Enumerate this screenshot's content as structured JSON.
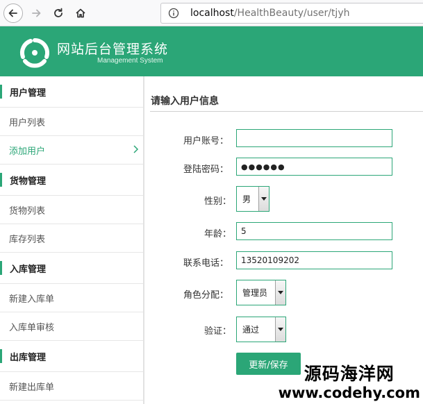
{
  "browser": {
    "url_host": "localhost",
    "url_path": "/HealthBeauty/user/tjyh"
  },
  "header": {
    "title": "网站后台管理系统",
    "subtitle": "Management System"
  },
  "sidebar": {
    "sections": [
      {
        "label": "用户管理",
        "items": [
          "用户列表",
          "添加用户"
        ]
      },
      {
        "label": "货物管理",
        "items": [
          "货物列表",
          "库存列表"
        ]
      },
      {
        "label": "入库管理",
        "items": [
          "新建入库单",
          "入库单审核"
        ]
      },
      {
        "label": "出库管理",
        "items": [
          "新建出库单"
        ]
      }
    ],
    "active_item": "添加用户"
  },
  "form": {
    "title": "请输入用户信息",
    "account_label": "用户账号：",
    "account_value": "",
    "password_label": "登陆密码：",
    "password_value": "●●●●●●",
    "gender_label": "性别：",
    "gender_value": "男",
    "age_label": "年龄：",
    "age_value": "5",
    "phone_label": "联系电话：",
    "phone_value": "13520109202",
    "role_label": "角色分配：",
    "role_value": "管理员",
    "verify_label": "验证：",
    "verify_value": "通过",
    "submit_label": "更新/保存"
  },
  "watermark": {
    "cn": "源码海洋网",
    "en": "www.codehy.com"
  },
  "colors": {
    "brand": "#2ba677"
  }
}
